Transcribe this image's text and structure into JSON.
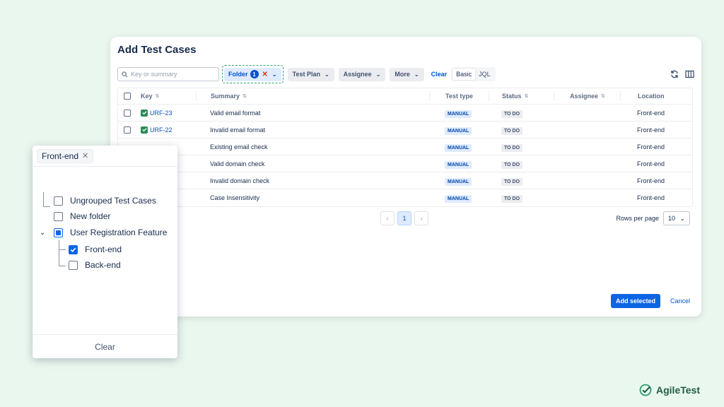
{
  "dialog": {
    "title": "Add Test Cases"
  },
  "toolbar": {
    "search_placeholder": "Key or summary",
    "folder_label": "Folder",
    "folder_count": "1",
    "test_plan_label": "Test Plan",
    "assignee_label": "Assignee",
    "more_label": "More",
    "clear_label": "Clear",
    "basic_label": "Basic",
    "jql_label": "JQL"
  },
  "table": {
    "headers": [
      "Key",
      "Summary",
      "Test type",
      "Status",
      "Assignee",
      "Location"
    ],
    "rows": [
      {
        "key": "URF-23",
        "summary": "Valid email format",
        "type": "MANUAL",
        "status": "TO DO",
        "assignee": "",
        "location": "Front-end"
      },
      {
        "key": "URF-22",
        "summary": "Invalid email format",
        "type": "MANUAL",
        "status": "TO DO",
        "assignee": "",
        "location": "Front-end"
      },
      {
        "key": "",
        "summary": "Existing email check",
        "type": "MANUAL",
        "status": "TO DO",
        "assignee": "",
        "location": "Front-end"
      },
      {
        "key": "",
        "summary": "Valid domain check",
        "type": "MANUAL",
        "status": "TO DO",
        "assignee": "",
        "location": "Front-end"
      },
      {
        "key": "",
        "summary": "Invalid domain check",
        "type": "MANUAL",
        "status": "TO DO",
        "assignee": "",
        "location": "Front-end"
      },
      {
        "key": "",
        "summary": "Case Insensitivity",
        "type": "MANUAL",
        "status": "TO DO",
        "assignee": "",
        "location": "Front-end"
      }
    ]
  },
  "pagination": {
    "current_page": "1",
    "rows_per_page_label": "Rows per page",
    "rows_per_page": "10"
  },
  "actions": {
    "add_selected": "Add selected",
    "cancel": "Cancel"
  },
  "folder_panel": {
    "selected_tag": "Front-end",
    "tree": {
      "ungrouped": "Ungrouped Test Cases",
      "new_folder": "New folder",
      "feature": "User Registration Feature",
      "front_end": "Front-end",
      "back_end": "Back-end"
    },
    "clear_label": "Clear"
  },
  "brand": {
    "name": "AgileTest"
  },
  "colors": {
    "accent": "#0c66e4",
    "brand": "#1f5c45",
    "background": "#eaf7ef",
    "highlight_border": "#36a07a"
  }
}
